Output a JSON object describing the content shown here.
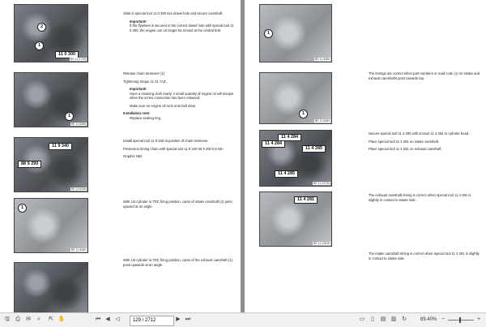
{
  "left_page": {
    "fig1": {
      "callouts": [
        "2",
        "1",
        "11 0 300"
      ],
      "img_id": "RE 11 0 225"
    },
    "fig2": {
      "callouts": [
        "1"
      ],
      "img_id": "RE 11 8385"
    },
    "fig3": {
      "callouts": [
        "11 9 340",
        "88 9 290"
      ],
      "img_id": "RE 11 8336"
    },
    "fig4": {
      "callouts": [
        "1"
      ],
      "img_id": "RE 11 8289"
    },
    "fig5": {
      "img_id": "RE 11 8271"
    },
    "text1": [
      "Slide in special tool 11 0 300 into dowel hole and secure camshaft."
    ],
    "text1_important": "Important!",
    "text1_note": "If the flywheel is secured in the correct dowel hole with special tool 11 0 300, the engine can no longer be moved at the central bolt.",
    "text2": [
      "Release chain tensioner (1).",
      "Tightening torque 11 31 7AZ."
    ],
    "text2_important": "Important!",
    "text2_note": "Have a cleaning cloth ready. A small quantity of engine oil will escape when the screw connection has been released.",
    "text2_note2": "Make sure no engine oil runs onto belt drive.",
    "text2_install": "Installation note:",
    "text2_install_note": "Replace sealing ring.",
    "text3": [
      "Install special tool 11 9 340 at position of chain tensioner.",
      "Pretension timing chain with special tool 11 9 340 00 9 250 0,6 Nm",
      "Graphic N62"
    ],
    "text4": [
      "With 1st cylinder in TDC firing position, cams of intake camshaft (1) point upward at an angle."
    ],
    "text5": [
      "With 1st cylinder in TDC firing position, cams of the exhaust camshaft (1) point upwards at an angle."
    ]
  },
  "right_page": {
    "fig1": {
      "callouts": [
        "1"
      ],
      "img_id": "RE 11 8380"
    },
    "fig2": {
      "callouts": [
        "1"
      ],
      "img_id": "RE 11 8383"
    },
    "fig3": {
      "callouts": [
        "11 4 284",
        "11 4 284",
        "11 4 285",
        "11 4 285"
      ],
      "img_id": "RE 11 22733"
    },
    "fig4": {
      "callouts": [
        "11 4 281"
      ],
      "img_id": "RE 11 22925"
    },
    "text1": [
      "The timings are correct when part numbers or read code (1) on intake and exhaust camshafts point towards top."
    ],
    "text2": [
      "Secure special tool 11 4 285 with screws 11 4 284 to cylinder head.",
      "Place special tool 11 4 281 on intake camshaft.",
      "Place special tool 11 4 281 on exhaust camshaft."
    ],
    "text3": [
      "The exhaust camshaft timing is correct when special tool 11 4 281 is slightly in contact to intake side."
    ],
    "text4": [
      "The intake camshaft timing is correct when special tool 11 4 281 is slightly in contact to intake side."
    ]
  },
  "toolbar": {
    "page_input": "129 / 2712",
    "zoom": "89.40%",
    "zoom_fraction": 0.45,
    "icons": [
      "save-icon",
      "print-icon",
      "email-icon",
      "search-icon",
      "select-icon",
      "hand-icon",
      "first-page-icon",
      "prev-page-icon",
      "next-page-icon",
      "last-page-icon",
      "fit-width-icon",
      "fit-page-icon",
      "single-page-icon",
      "two-page-icon",
      "rotate-icon",
      "zoom-out-icon",
      "zoom-in-icon"
    ]
  }
}
